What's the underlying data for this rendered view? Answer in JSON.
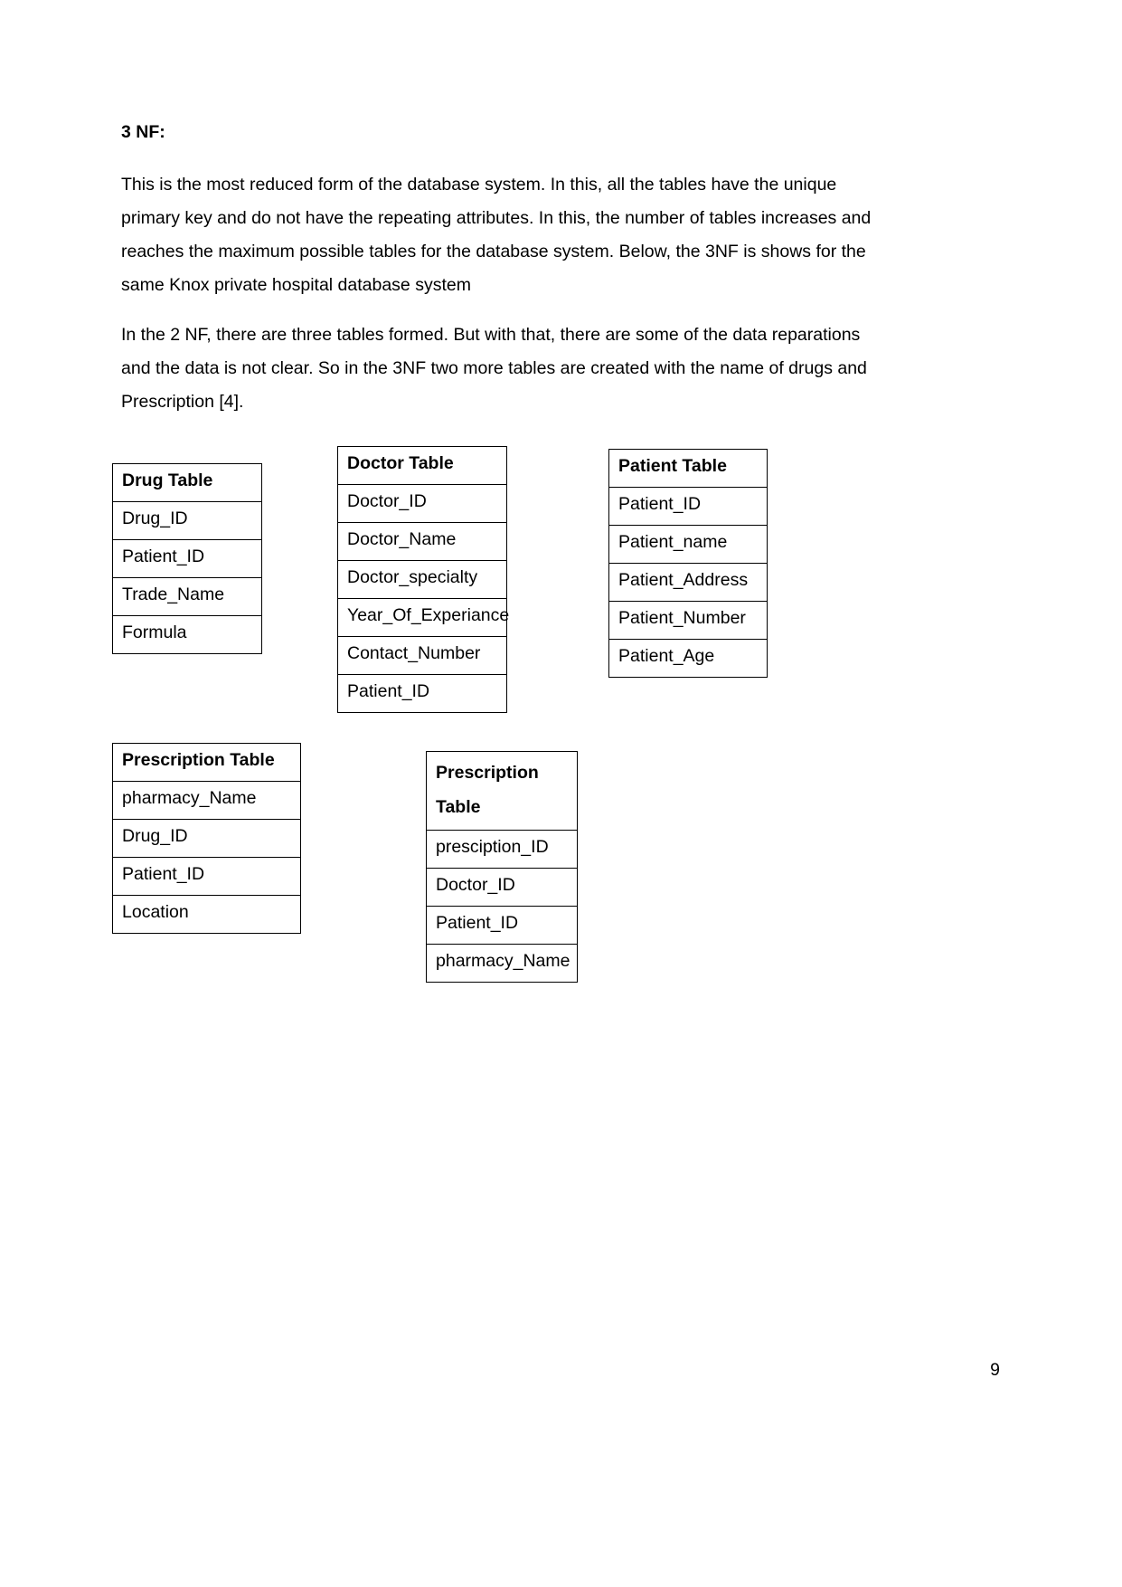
{
  "document": {
    "heading": "3 NF:",
    "paragraphs": [
      "This is the most reduced form of the database system. In this, all the tables have the unique primary key and do not have the repeating attributes. In this, the number of tables increases and reaches the maximum possible tables for the database system. Below, the 3NF is shows for the same Knox private hospital database system",
      "In the 2 NF, there are three tables formed. But with that, there are some of the data reparations and the data is not clear. So in the 3NF two more tables are created with the name of drugs and Prescription [4]."
    ],
    "page_number": "9"
  },
  "diagram": {
    "entities": [
      {
        "id": "drug",
        "title": "Drug Table",
        "fields": [
          "Drug_ID",
          "Patient_ID",
          "Trade_Name",
          "Formula"
        ]
      },
      {
        "id": "doctor",
        "title": "Doctor Table",
        "fields": [
          "Doctor_ID",
          "Doctor_Name",
          "Doctor_specialty",
          "Year_Of_Experiance",
          "Contact_Number",
          "Patient_ID"
        ]
      },
      {
        "id": "patient",
        "title": "Patient Table",
        "fields": [
          "Patient_ID",
          "Patient_name",
          "Patient_Address",
          "Patient_Number",
          "Patient_Age"
        ]
      },
      {
        "id": "prescription-left",
        "title": "Prescription Table",
        "fields": [
          "pharmacy_Name",
          "Drug_ID",
          "Patient_ID",
          "Location"
        ]
      },
      {
        "id": "prescription-right",
        "title": "Prescription Table",
        "title_line_1": "Prescription",
        "title_line_2": "Table",
        "fields": [
          "presciption_ID",
          "Doctor_ID",
          "Patient_ID",
          "pharmacy_Name"
        ]
      }
    ]
  }
}
